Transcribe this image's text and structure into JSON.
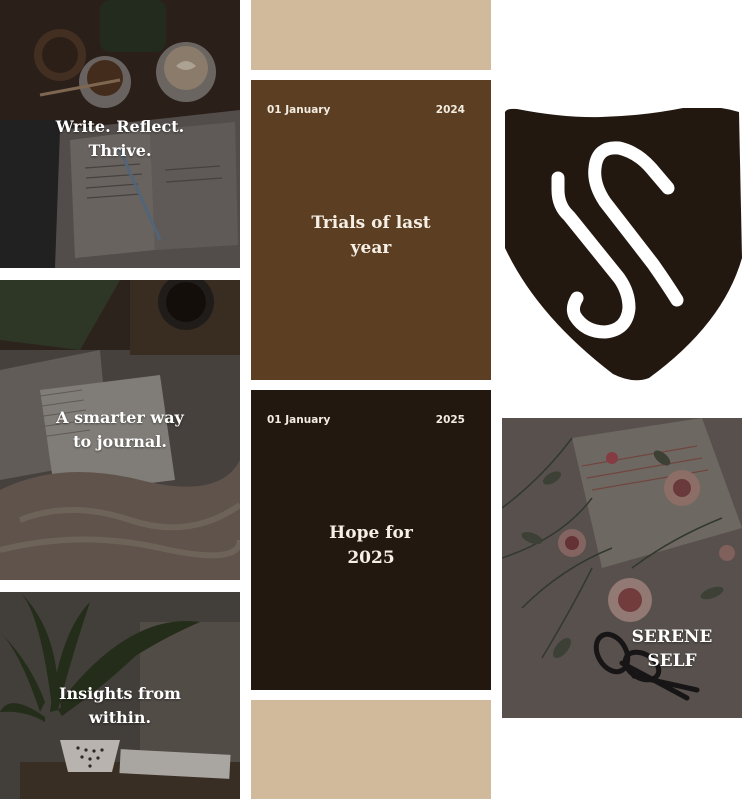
{
  "colors": {
    "brown_mid": "#5c3f22",
    "brown_dark": "#231810",
    "tan": "#d1b99c",
    "logo": "#231810",
    "text_light": "#ffffff"
  },
  "photos": [
    {
      "caption": "Write. Reflect. Thrive.",
      "scene": "coffee cups and open notebook"
    },
    {
      "caption": "A smarter way to journal.",
      "scene": "open book on cozy blanket with coffee"
    },
    {
      "caption": "Insights from within.",
      "scene": "plant, tea cup and notebooks"
    },
    {
      "caption": "SERENE SELF",
      "scene": "dried flowers, notebook and scissors"
    }
  ],
  "cards": [
    {
      "date": "01 January",
      "year": "2024",
      "title": "Trials of last year"
    },
    {
      "date": "01 January",
      "year": "2025",
      "title": "Hope for 2025"
    }
  ],
  "logo": {
    "icon": "shield-paperclip-icon"
  }
}
